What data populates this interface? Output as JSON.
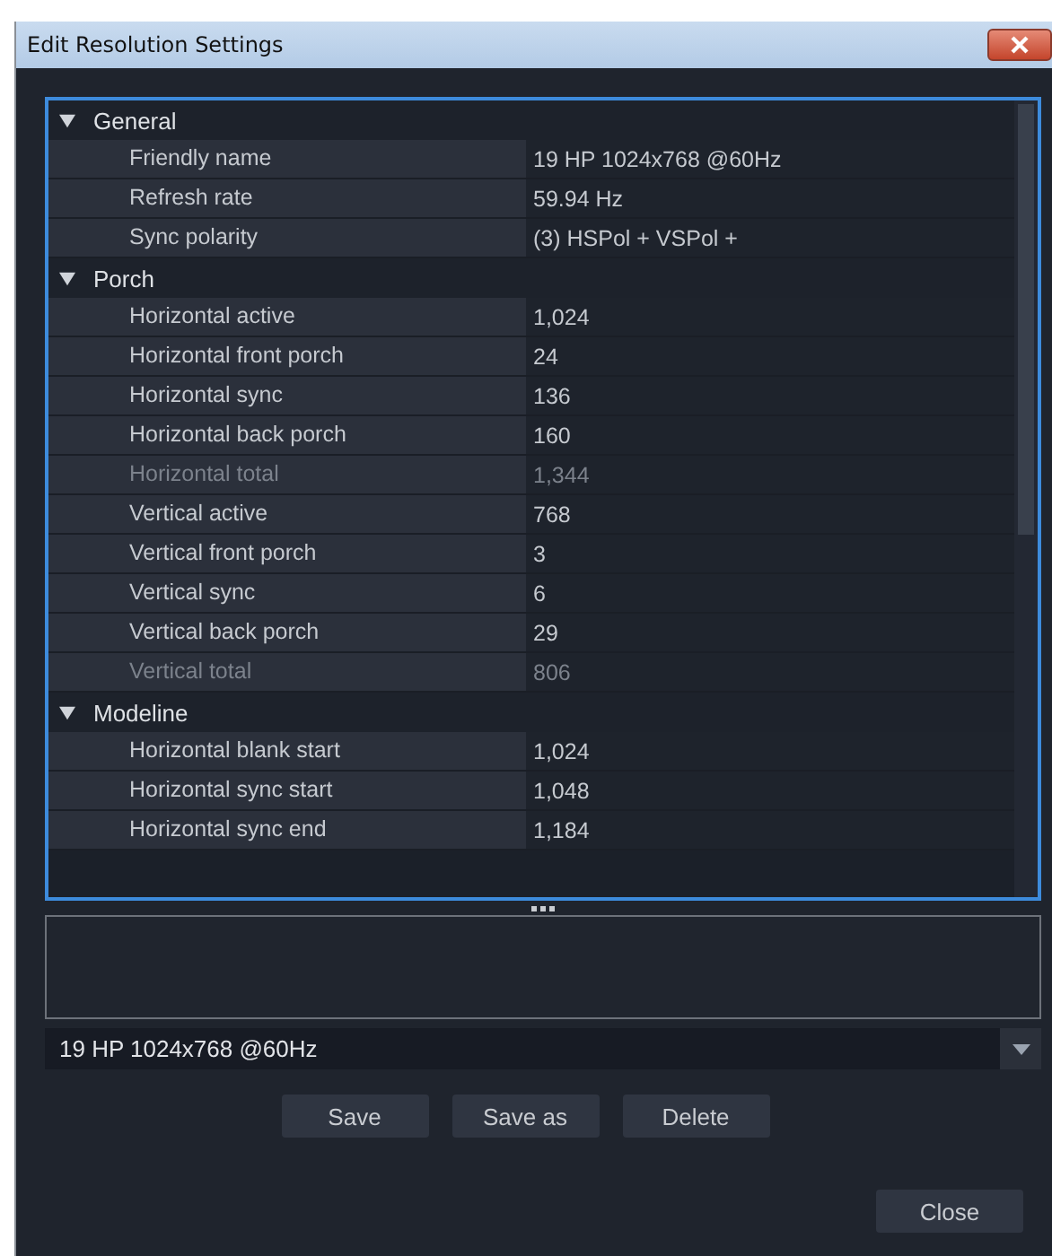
{
  "window": {
    "title": "Edit Resolution Settings"
  },
  "groups": [
    {
      "label": "General",
      "expanded": true,
      "items": [
        {
          "name": "Friendly name",
          "value": "19 HP 1024x768 @60Hz",
          "disabled": false
        },
        {
          "name": "Refresh rate",
          "value": "59.94 Hz",
          "disabled": false
        },
        {
          "name": "Sync polarity",
          "value": "(3) HSPol +  VSPol +",
          "disabled": false
        }
      ]
    },
    {
      "label": "Porch",
      "expanded": true,
      "items": [
        {
          "name": "Horizontal active",
          "value": "1,024",
          "disabled": false
        },
        {
          "name": "Horizontal front porch",
          "value": "24",
          "disabled": false
        },
        {
          "name": "Horizontal sync",
          "value": "136",
          "disabled": false
        },
        {
          "name": "Horizontal back porch",
          "value": "160",
          "disabled": false
        },
        {
          "name": "Horizontal total",
          "value": "1,344",
          "disabled": true
        },
        {
          "name": "Vertical active",
          "value": "768",
          "disabled": false
        },
        {
          "name": "Vertical front porch",
          "value": "3",
          "disabled": false
        },
        {
          "name": "Vertical sync",
          "value": "6",
          "disabled": false
        },
        {
          "name": "Vertical back porch",
          "value": "29",
          "disabled": false
        },
        {
          "name": "Vertical total",
          "value": "806",
          "disabled": true
        }
      ]
    },
    {
      "label": "Modeline",
      "expanded": true,
      "items": [
        {
          "name": "Horizontal blank start",
          "value": "1,024",
          "disabled": false
        },
        {
          "name": "Horizontal sync start",
          "value": "1,048",
          "disabled": false
        },
        {
          "name": "Horizontal sync end",
          "value": "1,184",
          "disabled": false
        }
      ]
    }
  ],
  "preset": {
    "value": "19 HP 1024x768 @60Hz"
  },
  "buttons": [
    "Save",
    "Save as",
    "Delete"
  ],
  "close_button": "Close"
}
